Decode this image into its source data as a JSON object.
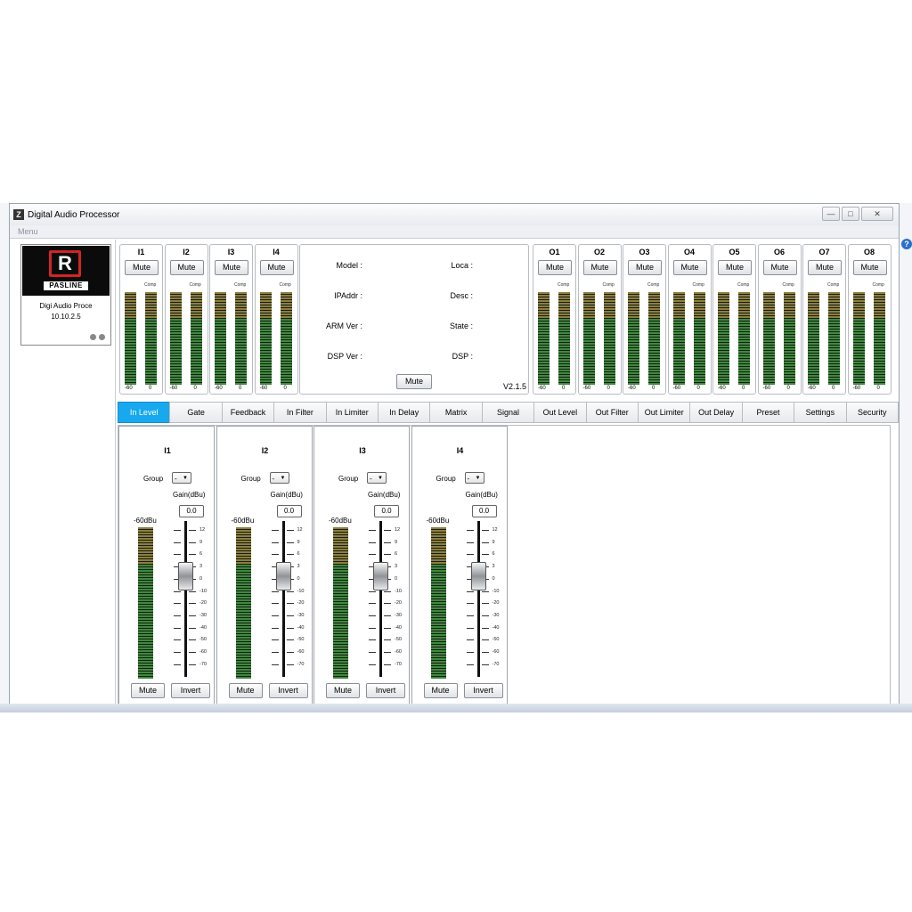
{
  "window": {
    "title": "Digital Audio Processor",
    "icon_text": "Z",
    "controls": [
      "—",
      "□",
      "✕"
    ],
    "menu": "Menu"
  },
  "device": {
    "logo_text": "PASLINE",
    "logo_mark": "R",
    "name": "Digi Audio Proce",
    "ip": "10.10.2.5"
  },
  "inputs": [
    {
      "label": "I1",
      "mute": "Mute",
      "comp": "Comp",
      "min": "-60",
      "max": "0"
    },
    {
      "label": "I2",
      "mute": "Mute",
      "comp": "Comp",
      "min": "-60",
      "max": "0"
    },
    {
      "label": "I3",
      "mute": "Mute",
      "comp": "Comp",
      "min": "-60",
      "max": "0"
    },
    {
      "label": "I4",
      "mute": "Mute",
      "comp": "Comp",
      "min": "-60",
      "max": "0"
    }
  ],
  "outputs": [
    {
      "label": "O1",
      "mute": "Mute",
      "comp": "Comp",
      "min": "-60",
      "max": "0"
    },
    {
      "label": "O2",
      "mute": "Mute",
      "comp": "Comp",
      "min": "-60",
      "max": "0"
    },
    {
      "label": "O3",
      "mute": "Mute",
      "comp": "Comp",
      "min": "-60",
      "max": "0"
    },
    {
      "label": "O4",
      "mute": "Mute",
      "comp": "Comp",
      "min": "-60",
      "max": "0"
    },
    {
      "label": "O5",
      "mute": "Mute",
      "comp": "Comp",
      "min": "-60",
      "max": "0"
    },
    {
      "label": "O6",
      "mute": "Mute",
      "comp": "Comp",
      "min": "-60",
      "max": "0"
    },
    {
      "label": "O7",
      "mute": "Mute",
      "comp": "Comp",
      "min": "-60",
      "max": "0"
    },
    {
      "label": "O8",
      "mute": "Mute",
      "comp": "Comp",
      "min": "-60",
      "max": "0"
    }
  ],
  "info": {
    "model": "Model :",
    "ipaddr": "IPAddr :",
    "arm": "ARM Ver :",
    "dsp_ver": "DSP Ver :",
    "loca": "Loca :",
    "desc": "Desc :",
    "state": "State :",
    "dsp": "DSP :",
    "mute": "Mute",
    "version": "V2.1.5"
  },
  "tabs": [
    "In Level",
    "Gate",
    "Feedback",
    "In Filter",
    "In Limiter",
    "In Delay",
    "Matrix",
    "Signal",
    "Out Level",
    "Out Filter",
    "Out Limiter",
    "Out Delay",
    "Preset",
    "Settings",
    "Security"
  ],
  "active_tab": "In Level",
  "level_channels": [
    {
      "label": "I1",
      "group_label": "Group",
      "group_value": "-",
      "gain_label": "Gain(dBu)",
      "gain_value": "0.0",
      "db_label": "-60dBu",
      "mute": "Mute",
      "invert": "Invert"
    },
    {
      "label": "I2",
      "group_label": "Group",
      "group_value": "-",
      "gain_label": "Gain(dBu)",
      "gain_value": "0.0",
      "db_label": "-60dBu",
      "mute": "Mute",
      "invert": "Invert"
    },
    {
      "label": "I3",
      "group_label": "Group",
      "group_value": "-",
      "gain_label": "Gain(dBu)",
      "gain_value": "0.0",
      "db_label": "-60dBu",
      "mute": "Mute",
      "invert": "Invert"
    },
    {
      "label": "I4",
      "group_label": "Group",
      "group_value": "-",
      "gain_label": "Gain(dBu)",
      "gain_value": "0.0",
      "db_label": "-60dBu",
      "mute": "Mute",
      "invert": "Invert"
    }
  ],
  "fader_scale": [
    "12",
    "9",
    "6",
    "3",
    "0",
    "-10",
    "-20",
    "-30",
    "-40",
    "-50",
    "-60",
    "-70"
  ],
  "colors": {
    "active_tab": "#18a8ee",
    "meter_green": "#3f8a3d",
    "meter_amber": "#8e7f3b",
    "logo_red": "#d32424"
  }
}
